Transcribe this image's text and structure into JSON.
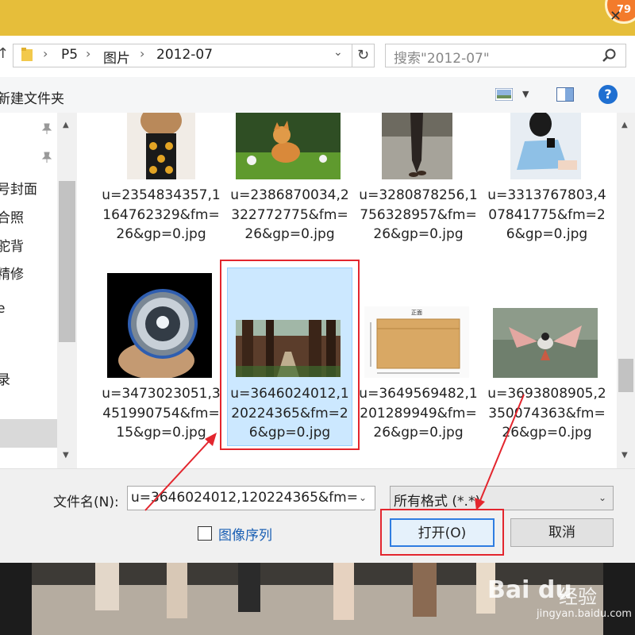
{
  "badge": {
    "text": "79"
  },
  "address": {
    "crumbs": [
      "P5",
      "图片",
      "2012-07"
    ],
    "search_placeholder": "搜索\"2012-07\""
  },
  "toolbar": {
    "new_folder": "新建文件夹"
  },
  "nav": {
    "items": [
      "号封面",
      "合照",
      "驼背",
      "精修",
      "e",
      "录"
    ]
  },
  "files": [
    "u=2354834357,1164762329&fm=26&gp=0.jpg",
    "u=2386870034,2322772775&fm=26&gp=0.jpg",
    "u=3280878256,1756328957&fm=26&gp=0.jpg",
    "u=3313767803,407841775&fm=26&gp=0.jpg",
    "u=3473023051,3451990754&fm=15&gp=0.jpg",
    "u=3646024012,120224365&fm=26&gp=0.jpg",
    "u=3649569482,1201289949&fm=26&gp=0.jpg",
    "u=3693808905,2350074363&fm=26&gp=0.jpg"
  ],
  "box_label": "正面",
  "bottom": {
    "filename_label": "文件名(N):",
    "filename_value": "u=3646024012,120224365&fm=",
    "format_value": "所有格式 (*.*)",
    "sequence_label": "图像序列",
    "open_label": "打开(O)",
    "cancel_label": "取消"
  },
  "watermark": {
    "brand": "Bai du",
    "sub": "经验",
    "url": "jingyan.baidu.com"
  },
  "colors": {
    "accent": "#2f7de1",
    "selection": "#cce8ff",
    "annotation": "#e3262e",
    "title_bar": "#e6be3a"
  }
}
